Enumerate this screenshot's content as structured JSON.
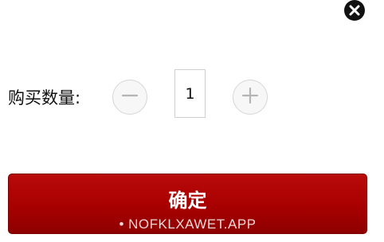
{
  "dialog": {
    "close_icon": "close-icon",
    "quantity_label": "购买数量:",
    "quantity_value": "1",
    "minus_icon": "minus-icon",
    "plus_icon": "plus-icon",
    "confirm_label": "确定",
    "watermark": "• NOFKLXAWET.APP"
  },
  "colors": {
    "confirm_bg": "#a80000",
    "confirm_text": "#ffffff",
    "stepper_bg": "#f7f7f7",
    "stepper_border": "#d6d6d6"
  }
}
